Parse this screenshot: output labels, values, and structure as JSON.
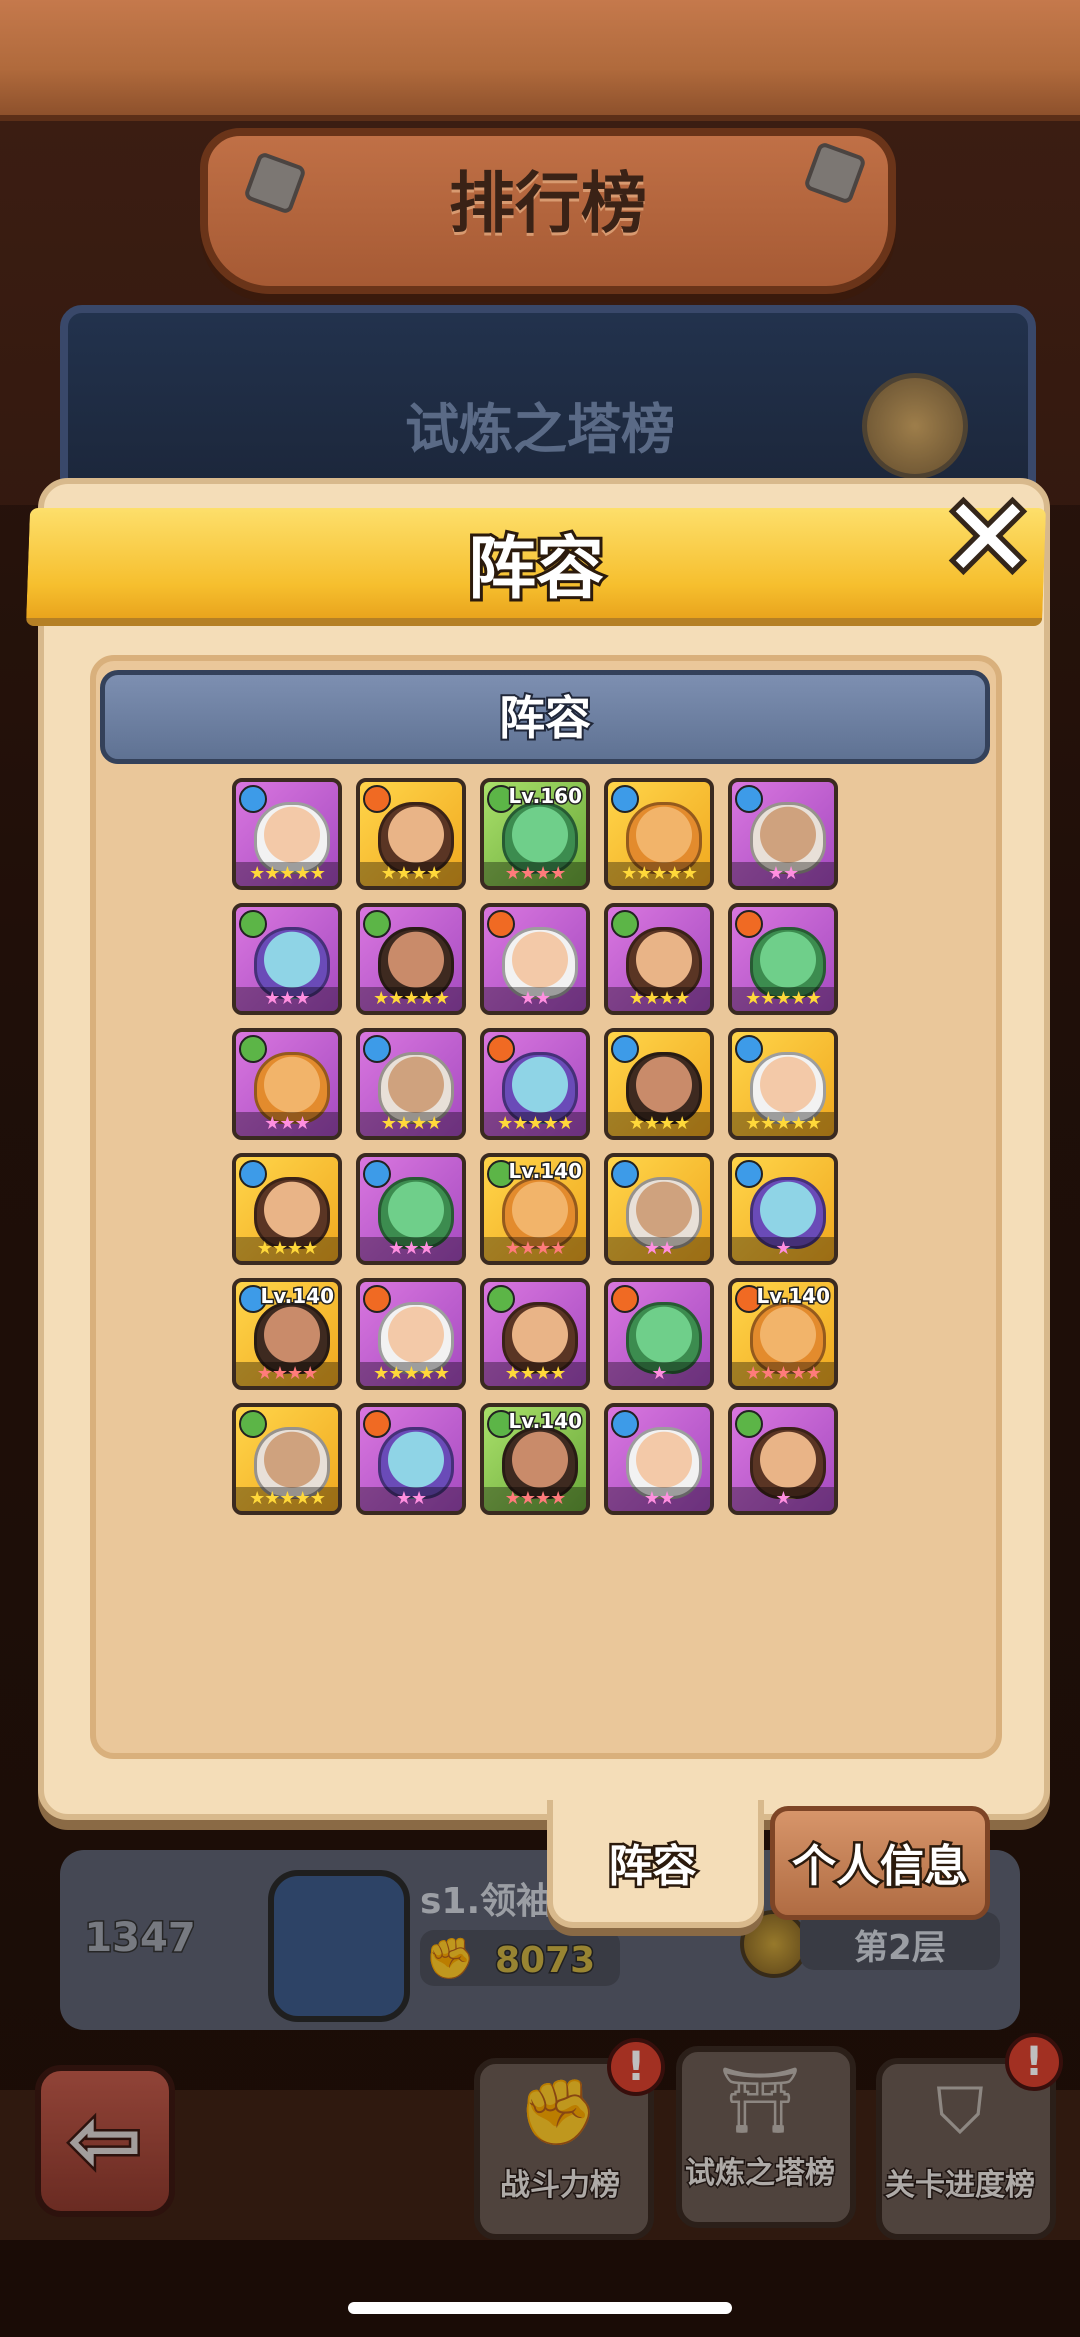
{
  "header": {
    "title": "排行榜"
  },
  "banner": {
    "title": "试炼之塔榜"
  },
  "modal": {
    "title": "阵容",
    "close_label": "✕",
    "section_title": "阵容"
  },
  "tabs": [
    {
      "label": "阵容",
      "active": true
    },
    {
      "label": "个人信息",
      "active": false
    }
  ],
  "player_row": {
    "rank": "1347",
    "name": "s1.领袖",
    "power": "8073",
    "floor": "第2层"
  },
  "nav": {
    "back_icon": "back-arrow-icon",
    "items": [
      {
        "label": "战斗力榜",
        "icon": "fist-icon",
        "alert": "!"
      },
      {
        "label": "试炼之塔榜",
        "icon": "tower-icon",
        "alert": ""
      },
      {
        "label": "关卡进度榜",
        "icon": "shield-icon",
        "alert": "!"
      }
    ]
  },
  "heroes": [
    {
      "element": "water",
      "frame": "purple",
      "level": "",
      "stars": "★★★★★",
      "star_color": "gold"
    },
    {
      "element": "fire",
      "frame": "gold",
      "level": "",
      "stars": "★★★★",
      "star_color": "gold"
    },
    {
      "element": "leaf",
      "frame": "green",
      "level": "Lv.160",
      "stars": "★★★★",
      "star_color": "red"
    },
    {
      "element": "water",
      "frame": "gold",
      "level": "",
      "stars": "★★★★★",
      "star_color": "gold"
    },
    {
      "element": "water",
      "frame": "purple",
      "level": "",
      "stars": "★★",
      "star_color": "pink"
    },
    {
      "element": "leaf",
      "frame": "purple",
      "level": "",
      "stars": "★★★",
      "star_color": "pink"
    },
    {
      "element": "leaf",
      "frame": "purple",
      "level": "",
      "stars": "★★★★★",
      "star_color": "gold"
    },
    {
      "element": "fire",
      "frame": "purple",
      "level": "",
      "stars": "★★",
      "star_color": "pink"
    },
    {
      "element": "leaf",
      "frame": "purple",
      "level": "",
      "stars": "★★★★",
      "star_color": "gold"
    },
    {
      "element": "fire",
      "frame": "purple",
      "level": "",
      "stars": "★★★★★",
      "star_color": "gold"
    },
    {
      "element": "leaf",
      "frame": "purple",
      "level": "",
      "stars": "★★★",
      "star_color": "pink"
    },
    {
      "element": "water",
      "frame": "purple",
      "level": "",
      "stars": "★★★★",
      "star_color": "gold"
    },
    {
      "element": "fire",
      "frame": "purple",
      "level": "",
      "stars": "★★★★★",
      "star_color": "gold"
    },
    {
      "element": "water",
      "frame": "gold",
      "level": "",
      "stars": "★★★★",
      "star_color": "gold"
    },
    {
      "element": "water",
      "frame": "gold",
      "level": "",
      "stars": "★★★★★",
      "star_color": "gold"
    },
    {
      "element": "water",
      "frame": "gold",
      "level": "",
      "stars": "★★★★",
      "star_color": "gold"
    },
    {
      "element": "water",
      "frame": "purple",
      "level": "",
      "stars": "★★★",
      "star_color": "pink"
    },
    {
      "element": "leaf",
      "frame": "gold",
      "level": "Lv.140",
      "stars": "★★★★",
      "star_color": "red"
    },
    {
      "element": "water",
      "frame": "gold",
      "level": "",
      "stars": "★★",
      "star_color": "pink"
    },
    {
      "element": "water",
      "frame": "gold",
      "level": "",
      "stars": "★",
      "star_color": "pink"
    },
    {
      "element": "water",
      "frame": "gold",
      "level": "Lv.140",
      "stars": "★★★★",
      "star_color": "red"
    },
    {
      "element": "fire",
      "frame": "purple",
      "level": "",
      "stars": "★★★★★",
      "star_color": "gold"
    },
    {
      "element": "leaf",
      "frame": "purple",
      "level": "",
      "stars": "★★★★",
      "star_color": "gold"
    },
    {
      "element": "fire",
      "frame": "purple",
      "level": "",
      "stars": "★",
      "star_color": "pink"
    },
    {
      "element": "fire",
      "frame": "gold",
      "level": "Lv.140",
      "stars": "★★★★★",
      "star_color": "red"
    },
    {
      "element": "leaf",
      "frame": "gold",
      "level": "",
      "stars": "★★★★★",
      "star_color": "gold"
    },
    {
      "element": "fire",
      "frame": "purple",
      "level": "",
      "stars": "★★",
      "star_color": "pink"
    },
    {
      "element": "leaf",
      "frame": "green",
      "level": "Lv.140",
      "stars": "★★★★",
      "star_color": "red"
    },
    {
      "element": "water",
      "frame": "purple",
      "level": "",
      "stars": "★★",
      "star_color": "pink"
    },
    {
      "element": "leaf",
      "frame": "purple",
      "level": "",
      "stars": "★",
      "star_color": "pink"
    }
  ]
}
